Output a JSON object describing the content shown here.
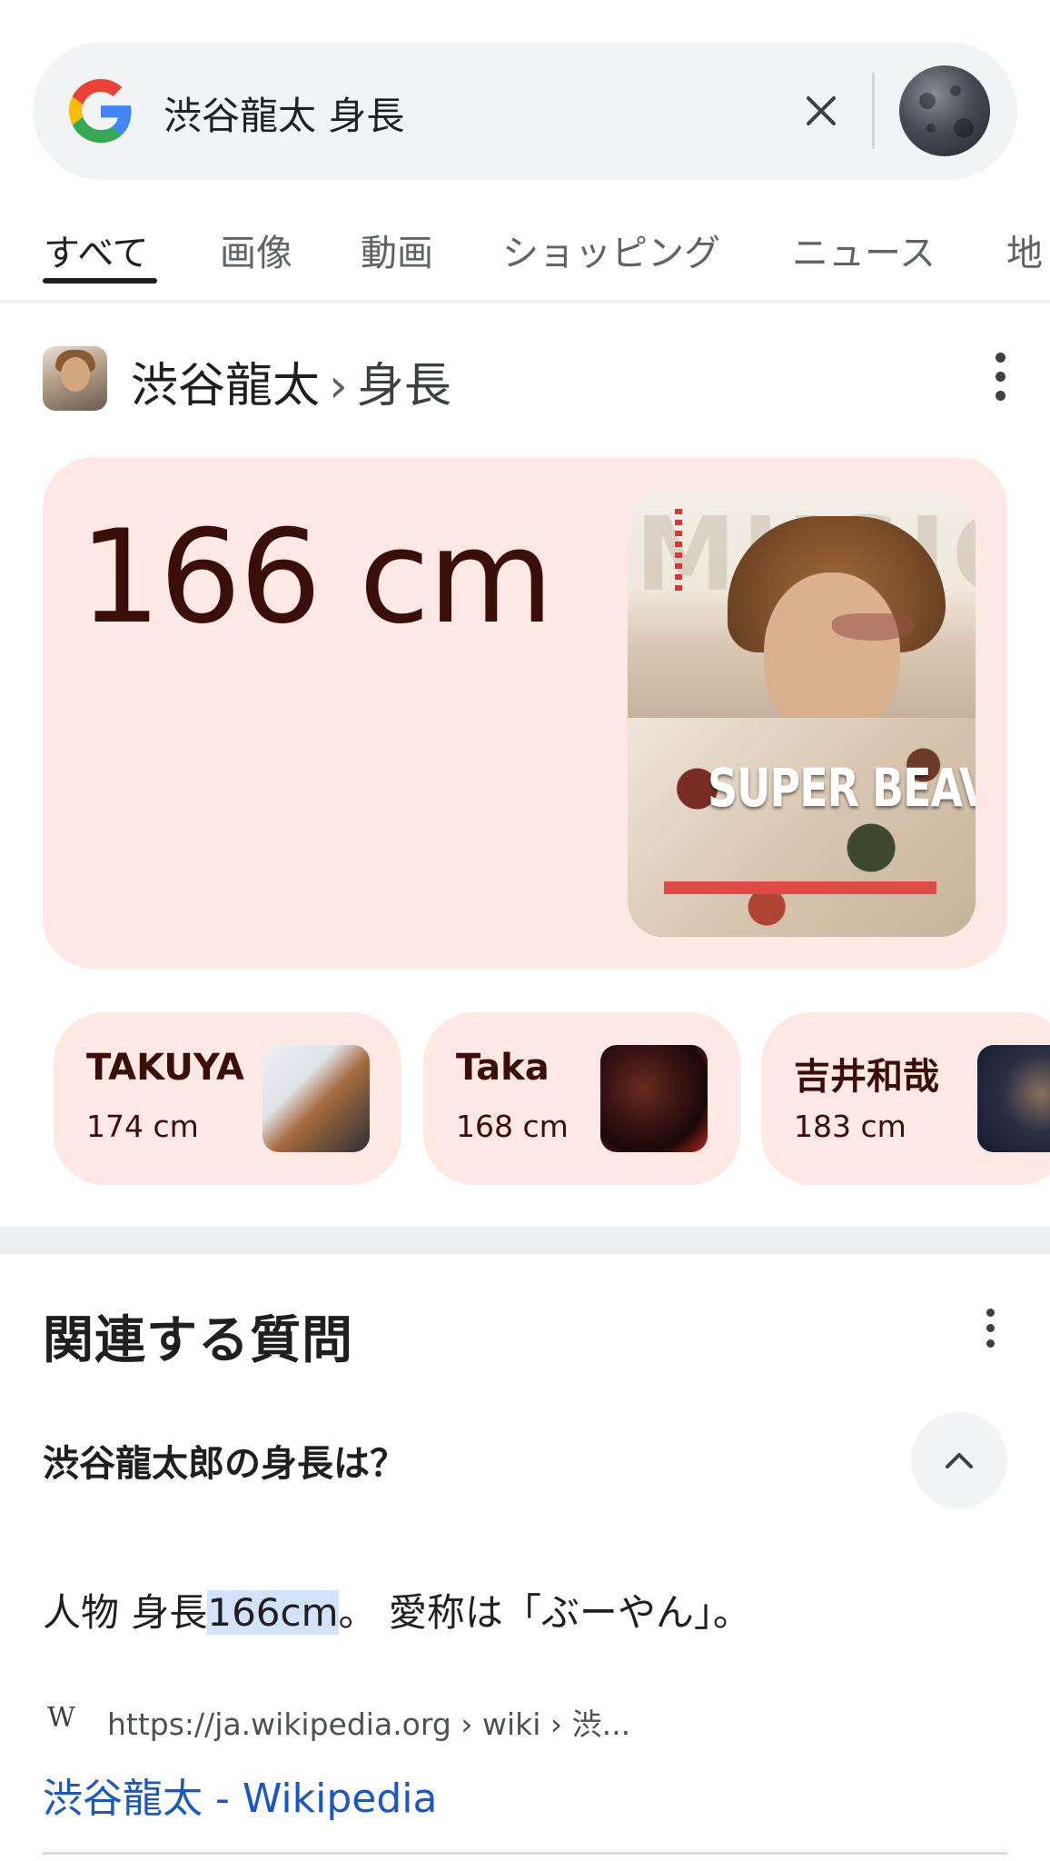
{
  "search": {
    "query": "渋谷龍太 身長",
    "logo_icon": "google-g-icon",
    "clear_icon": "close-icon",
    "avatar_icon": "moon-avatar-icon"
  },
  "tabs": [
    {
      "label": "すべて",
      "active": true
    },
    {
      "label": "画像",
      "active": false
    },
    {
      "label": "動画",
      "active": false
    },
    {
      "label": "ショッピング",
      "active": false
    },
    {
      "label": "ニュース",
      "active": false
    },
    {
      "label": "地",
      "active": false
    }
  ],
  "knowledge": {
    "entity": "渋谷龍太",
    "separator": "›",
    "attribute": "身長",
    "height": "166 cm",
    "cover_text": "SUPER BEAVER",
    "cover_masthead": "MUSICA"
  },
  "related_people": [
    {
      "name": "TAKUYA",
      "height": "174 cm"
    },
    {
      "name": "Taka",
      "height": "168 cm"
    },
    {
      "name": "吉井和哉",
      "height": "183 cm"
    }
  ],
  "related_questions": {
    "title": "関連する質問",
    "question": "渋谷龍太郎の身長は？",
    "answer_prefix": "人物 身長",
    "answer_highlight": "166cm",
    "answer_suffix": "。 愛称は「ぶーやん」。",
    "source_favicon": "W",
    "source_url": "https://ja.wikipedia.org › wiki › 渋...",
    "source_title": "渋谷龍太 - Wikipedia"
  },
  "colors": {
    "card_bg": "#fde8e3",
    "card_text": "#3a0f0a",
    "link": "#1a57c2",
    "highlight": "#d3e3fd"
  }
}
